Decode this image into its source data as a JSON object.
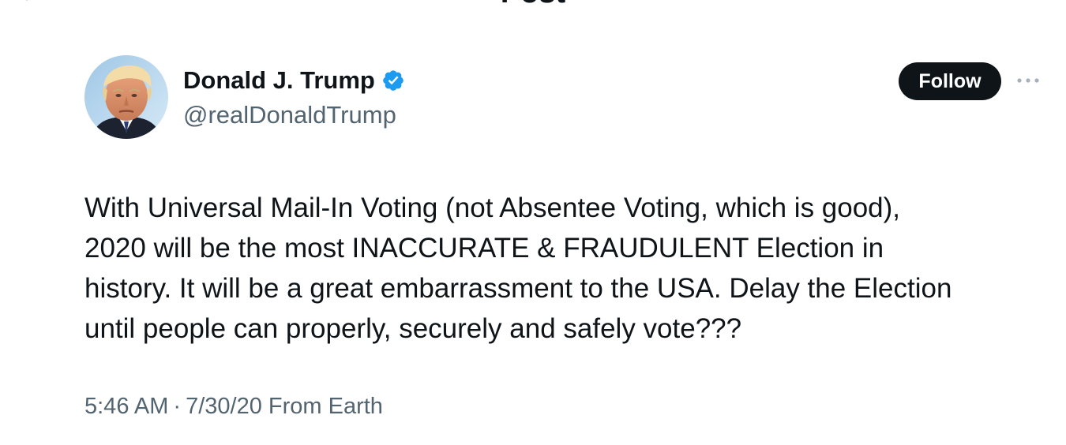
{
  "header": {
    "back_icon": "arrow-left-icon",
    "title": "Post"
  },
  "author": {
    "display_name": "Donald J. Trump",
    "handle": "@realDonaldTrump",
    "verified_icon": "verified-badge-icon",
    "verified_color": "#1d9bf0"
  },
  "actions": {
    "follow_label": "Follow",
    "more_icon": "more-horizontal-icon"
  },
  "tweet": {
    "lines": [
      "With Universal Mail-In Voting (not Absentee Voting, which is good),",
      "2020 will be the most INACCURATE & FRAUDULENT Election in",
      "history. It will be a great embarrassment to the USA. Delay the Election",
      "until people can properly, securely and safely vote???"
    ],
    "time": "5:46 AM",
    "separator": "·",
    "date": "7/30/20",
    "location": "From Earth"
  },
  "colors": {
    "text_primary": "#0f1419",
    "text_secondary": "#536471",
    "follow_bg": "#0f1419",
    "follow_text": "#ffffff"
  }
}
